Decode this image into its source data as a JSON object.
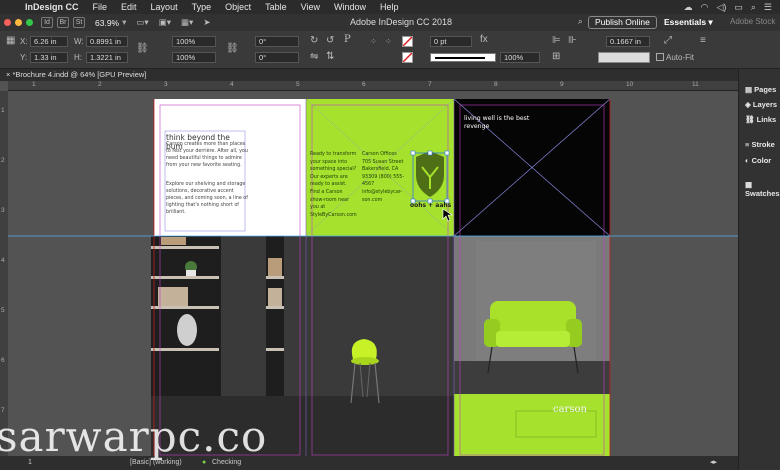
{
  "menubar": {
    "app_name": "InDesign CC",
    "items": [
      "File",
      "Edit",
      "Layout",
      "Type",
      "Object",
      "Table",
      "View",
      "Window",
      "Help"
    ]
  },
  "appbar": {
    "zoom": "63.9%",
    "title": "Adobe InDesign CC 2018",
    "publish_label": "Publish Online",
    "workspace": "Essentials",
    "stock_label": "Adobe Stock"
  },
  "control": {
    "x_label": "X:",
    "x_value": "6.26 in",
    "y_label": "Y:",
    "y_value": "1.33 in",
    "w_label": "W:",
    "w_value": "0.8991 in",
    "h_label": "H:",
    "h_value": "1.3221 in",
    "scale_x": "100%",
    "scale_y": "100%",
    "rotate": "0°",
    "shear": "0°",
    "stroke_weight": "0 pt",
    "opacity": "100%",
    "gap": "0.1667 in",
    "auto_fit": "Auto-Fit"
  },
  "document_tab": "*Brochure 4.indd @ 64% [GPU Preview]",
  "ruler_ticks": [
    "1",
    "2",
    "3",
    "4",
    "5",
    "6",
    "7",
    "8",
    "9",
    "10",
    "11"
  ],
  "ruler_v_ticks": [
    "1",
    "2",
    "3",
    "4",
    "5",
    "6",
    "7"
  ],
  "panels": [
    "Pages",
    "Layers",
    "Links",
    "Stroke",
    "Color",
    "Swatches"
  ],
  "page": {
    "panel1_heading": "think beyond the bum",
    "panel1_body": "Carson creates more than places to rest your derrière. After all, you need beautiful things to admire from your new favorite seating.",
    "panel1_body2": "Explore our shelving and storage solutions, decorative accent pieces, and coming soon, a line of lighting that's nothing short of brilliant.",
    "panel2_text": "Ready to transform your space into something special? Our experts are ready to assist. Find a Carson show-room near you at StyleByCarson.com",
    "panel2_address": "Carson Offices 705 Susan Street Bakersfield, CA 93309 (800) 555-4567 info@stylebycar-son.com",
    "logo_text": "oohs + aahs",
    "panel3_text": "living well is the best revenge",
    "brand": "carson"
  },
  "statusbar": {
    "page": "1",
    "style": "[Basic] (working)",
    "preflight": "Checking"
  },
  "watermark": "sarwarpc.co",
  "colors": {
    "accent_green": "#a6e12e",
    "black_panel": "#050505"
  }
}
